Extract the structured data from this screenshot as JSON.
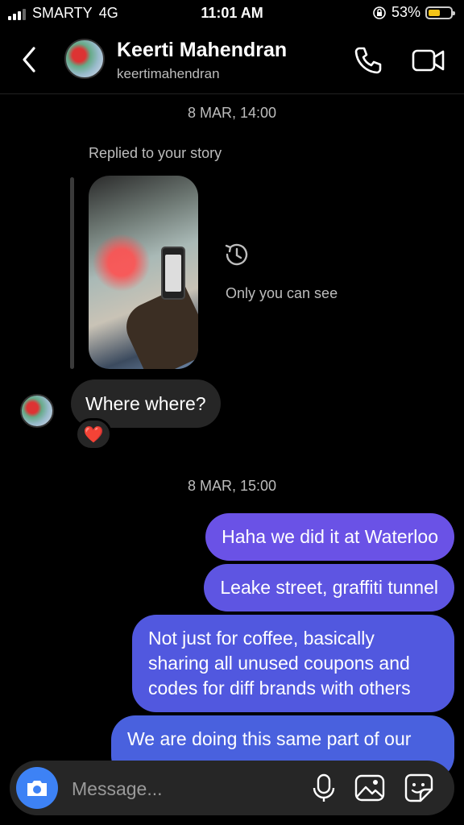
{
  "status_bar": {
    "carrier": "SMARTY",
    "network": "4G",
    "time": "11:01 AM",
    "battery": "53%",
    "battery_level": 0.53
  },
  "header": {
    "name": "Keerti Mahendran",
    "handle": "keertimahendran"
  },
  "conversation": {
    "timestamp_1": "8 MAR, 14:00",
    "replied_label": "Replied to your story",
    "story_notice": "Only you can see",
    "incoming_message": "Where where?",
    "reaction": "❤️",
    "timestamp_2": "8 MAR, 15:00",
    "outgoing_messages": [
      "Haha we did it at Waterloo",
      "Leake street, graffiti tunnel",
      "Not just for coffee, basically sharing all unused coupons and codes for diff brands with others",
      "We are doing this same part of our"
    ]
  },
  "composer": {
    "placeholder": "Message..."
  },
  "colors": {
    "accent_blue": "#3d82f5",
    "bubble_purple": "#5b51e0",
    "bubble_incoming": "#262626"
  }
}
